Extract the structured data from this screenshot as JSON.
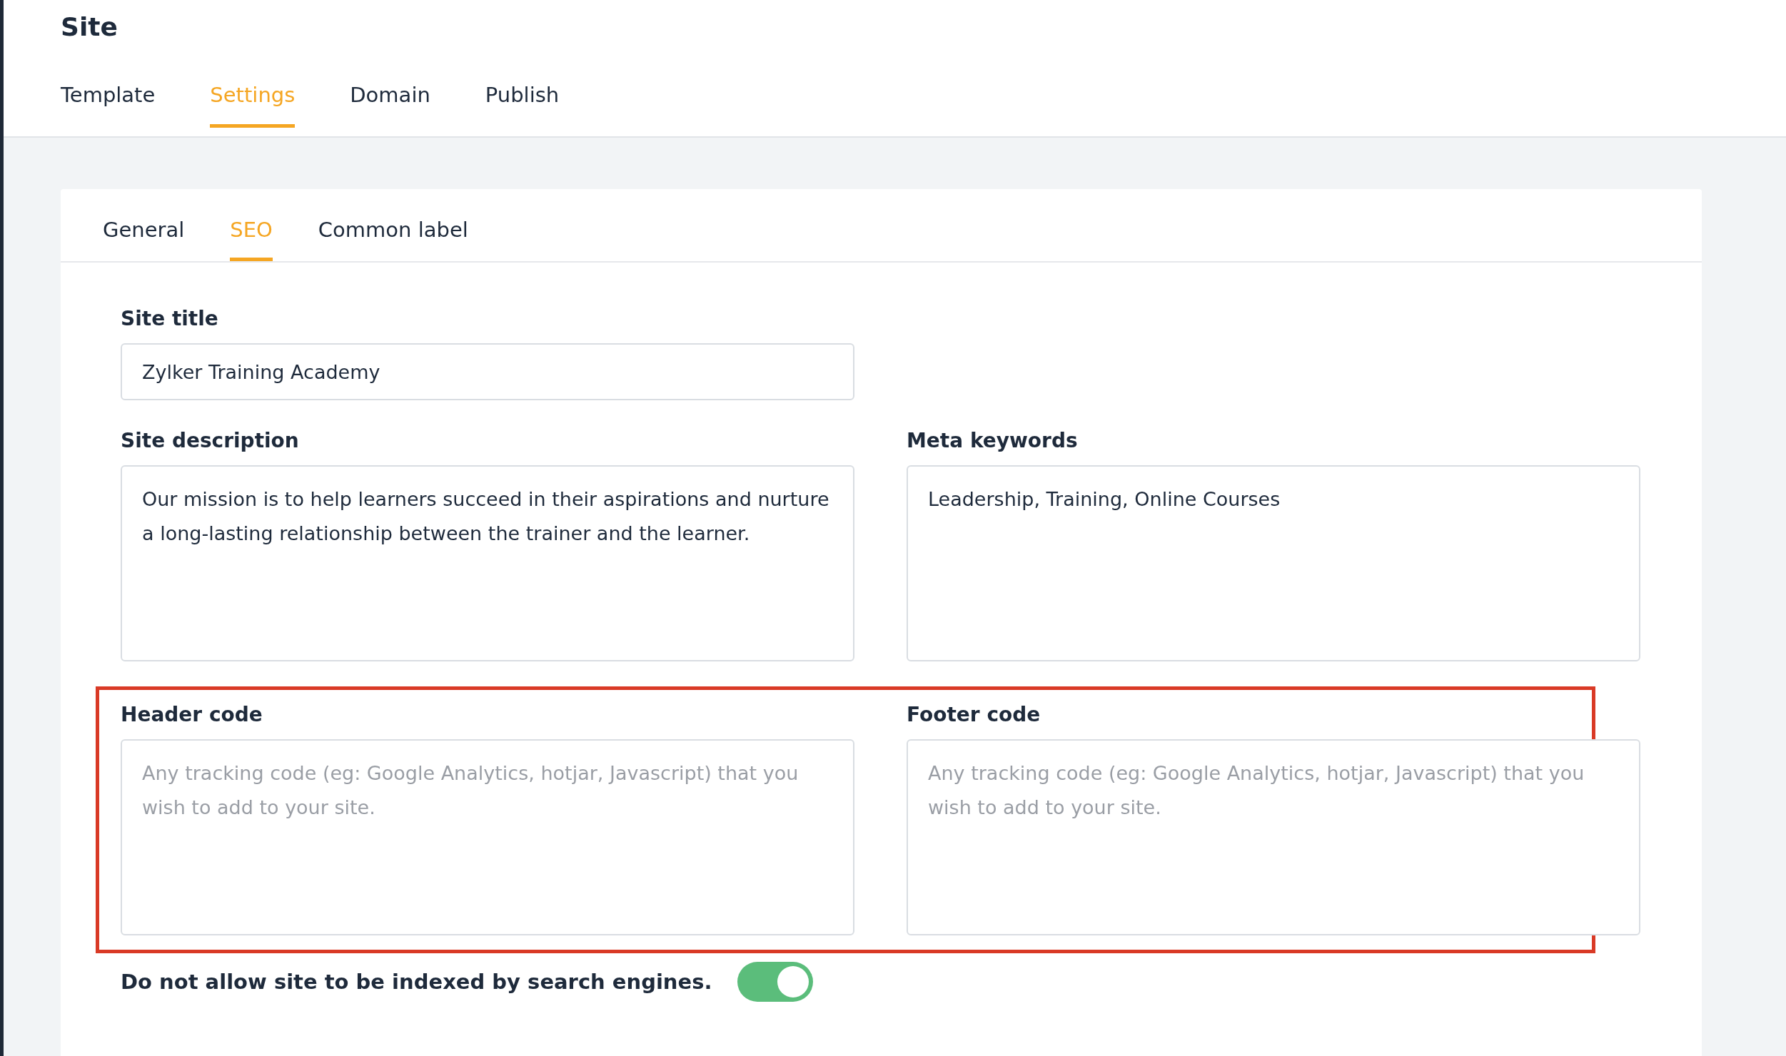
{
  "page": {
    "title": "Site"
  },
  "tabs": [
    {
      "label": "Template",
      "selected": false
    },
    {
      "label": "Settings",
      "selected": true
    },
    {
      "label": "Domain",
      "selected": false
    },
    {
      "label": "Publish",
      "selected": false
    }
  ],
  "subtabs": [
    {
      "label": "General",
      "selected": false
    },
    {
      "label": "SEO",
      "selected": true
    },
    {
      "label": "Common label",
      "selected": false
    }
  ],
  "site_title": {
    "label": "Site title",
    "value": "Zylker Training Academy"
  },
  "site_description": {
    "label": "Site description",
    "value": "Our mission is to help learners succeed in their aspirations and nurture a long-lasting relationship between the trainer and the learner."
  },
  "meta_keywords": {
    "label": "Meta keywords",
    "value": "Leadership, Training, Online Courses"
  },
  "code_section": {
    "highlighted": true,
    "header_code": {
      "label": "Header code",
      "placeholder": "Any tracking code (eg: Google Analytics, hotjar, Javascript) that you wish to add to your site."
    },
    "footer_code": {
      "label": "Footer code",
      "placeholder": "Any tracking code (eg: Google Analytics, hotjar, Javascript) that you wish to add to your site."
    }
  },
  "no_index": {
    "label": "Do not allow site to be indexed by search engines.",
    "on": true
  }
}
